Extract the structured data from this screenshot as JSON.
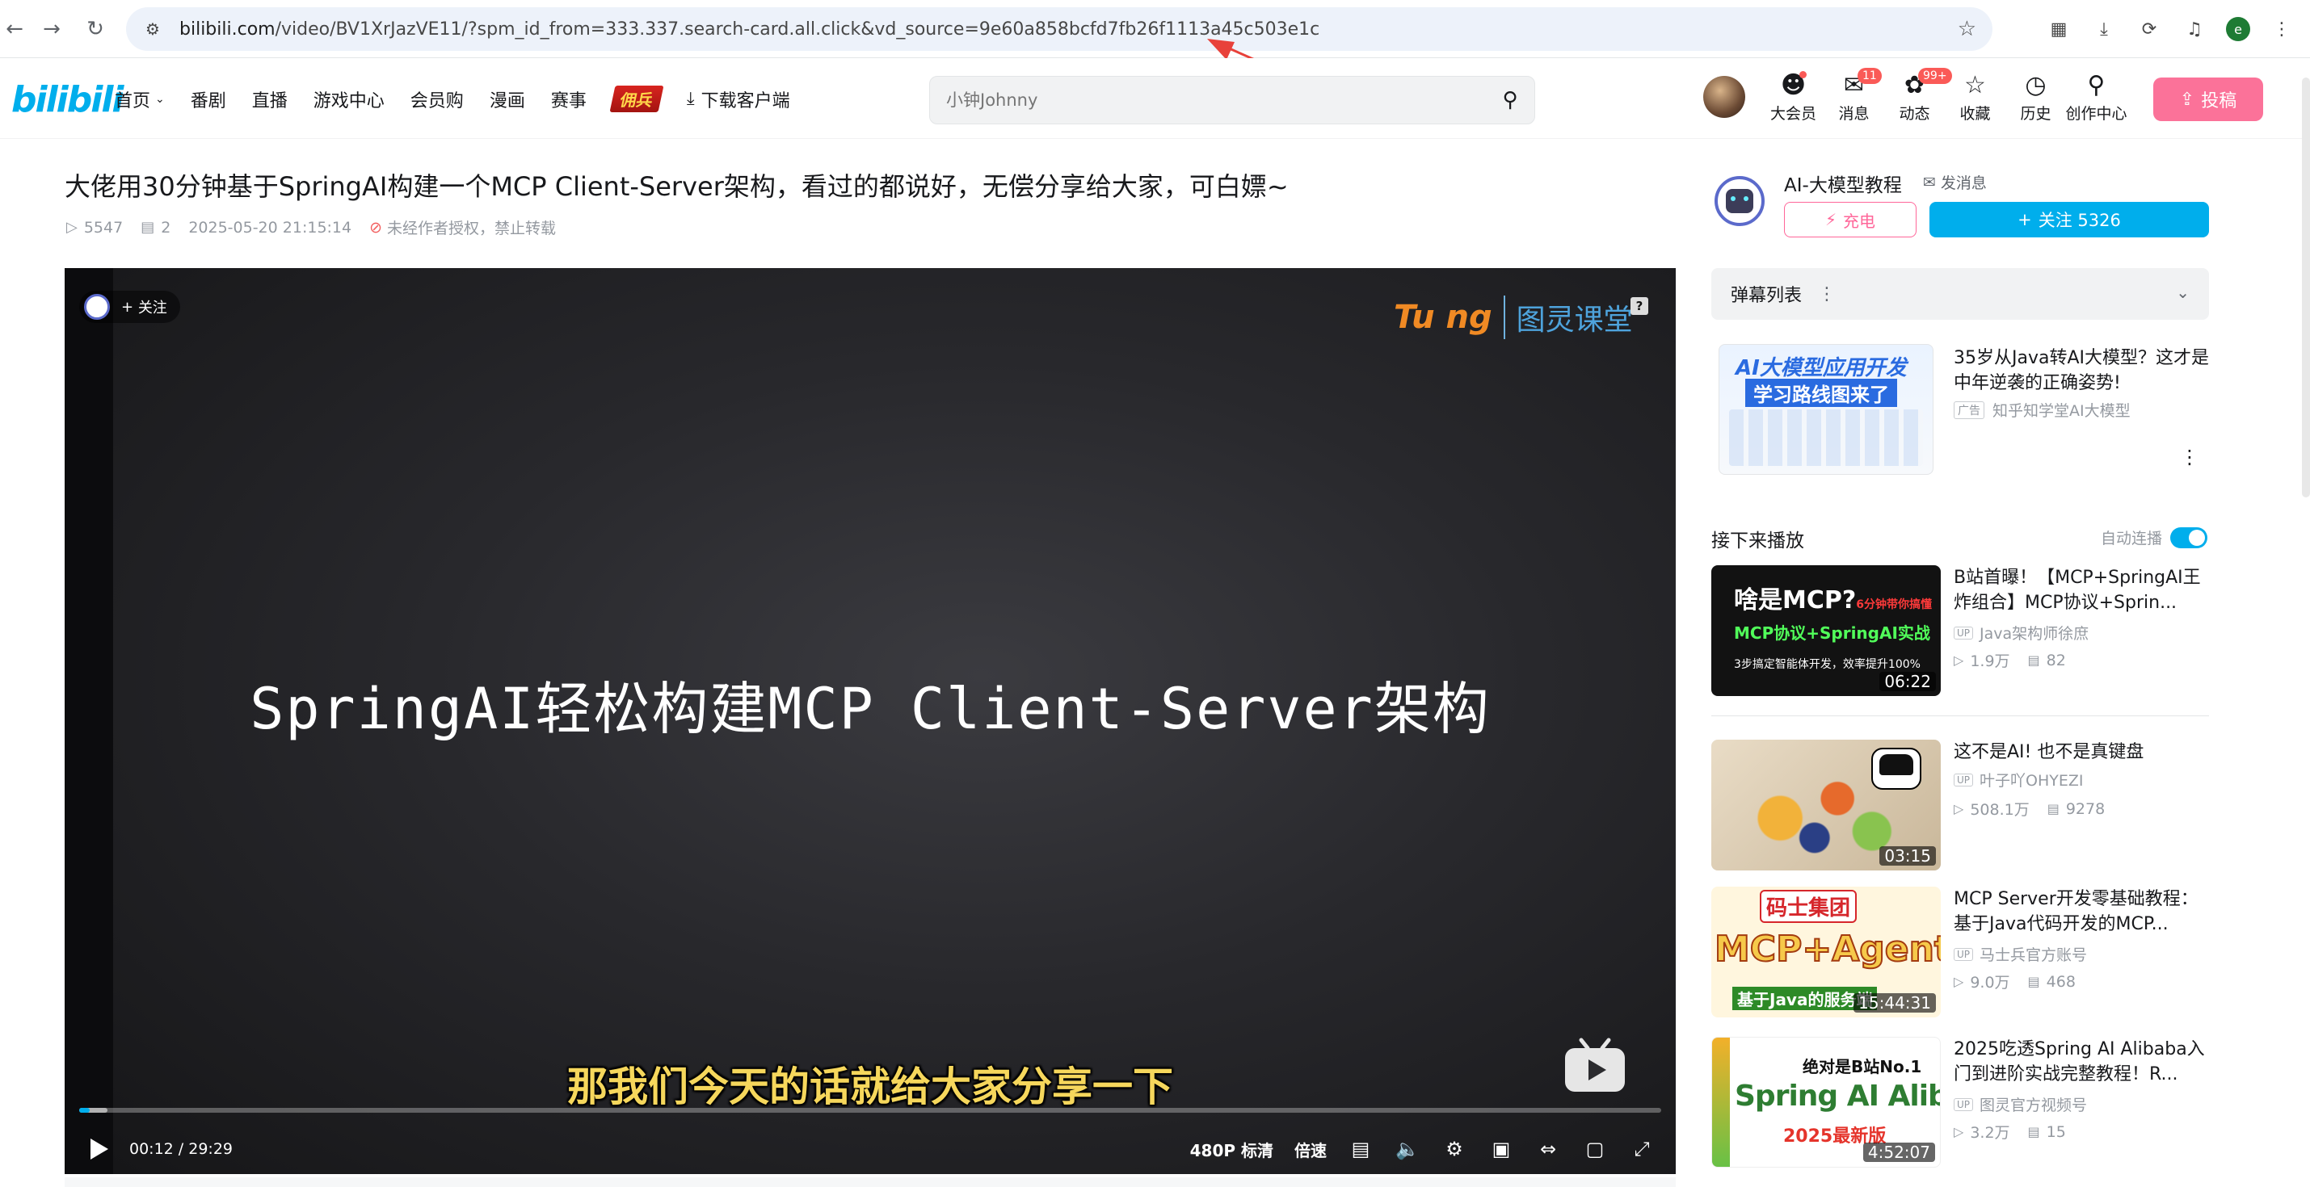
{
  "browser": {
    "url_host": "bilibili.com",
    "url_path": "/video/BV1XrJazVE11/?spm_id_from=333.337.search-card.all.click&vd_source=9e60a858bcfd7fb26f1113a45c503e1c",
    "profile_initial": "e"
  },
  "header": {
    "logo": "bilibili",
    "nav": [
      {
        "label": "首页",
        "has_dropdown": true
      },
      {
        "label": "番剧"
      },
      {
        "label": "直播"
      },
      {
        "label": "游戏中心"
      },
      {
        "label": "会员购"
      },
      {
        "label": "漫画"
      },
      {
        "label": "赛事"
      }
    ],
    "promo_label": "佣兵",
    "download_label": "下载客户端",
    "search_placeholder": "小钟Johnny",
    "icons": [
      {
        "label": "大会员",
        "icon": "member-icon",
        "dot": true
      },
      {
        "label": "消息",
        "icon": "message-icon",
        "badge": "11"
      },
      {
        "label": "动态",
        "icon": "dynamic-icon",
        "badge": "99+"
      },
      {
        "label": "收藏",
        "icon": "favorite-icon"
      },
      {
        "label": "历史",
        "icon": "history-icon"
      },
      {
        "label": "创作中心",
        "icon": "creator-icon"
      }
    ],
    "upload_label": "投稿"
  },
  "video": {
    "title": "大佬用30分钟基于SpringAI构建一个MCP Client-Server架构，看过的都说好，无偿分享给大家，可白嫖~",
    "views": "5547",
    "danmaku_count": "2",
    "date": "2025-05-20 21:15:14",
    "copyright_notice": "未经作者授权，禁止转载"
  },
  "player": {
    "follow_label": "关注",
    "brand_en": "Tu ng",
    "brand_cn": "图灵课堂",
    "slide_title": "SpringAI轻松构建MCP Client-Server架构",
    "subtitle": "那我们今天的话就给大家分享一下",
    "current_time": "00:12",
    "total_time": "29:29",
    "progress_fraction": 0.0068,
    "buffered_fraction": 0.018,
    "quality_label": "480P 标清",
    "speed_label": "倍速",
    "accent_color": "#00aeec"
  },
  "uploader": {
    "name": "AI-大模型教程",
    "message_label": "发消息",
    "charge_label": "充电",
    "follow_label": "关注 5326"
  },
  "danmaku_panel": {
    "label": "弹幕列表"
  },
  "ad": {
    "thumb_line1": "AI大模型应用开发",
    "thumb_line2": "学习路线图来了",
    "title": "35岁从Java转AI大模型？这才是中年逆袭的正确姿势!",
    "tag": "广告",
    "advertiser": "知乎知学堂AI大模型"
  },
  "up_next": {
    "label": "接下来播放",
    "autoplay_label": "自动连播",
    "autoplay_on": true
  },
  "recommendations": [
    {
      "title": "B站首曝！【MCP+SpringAI王炸组合】MCP协议+Sprin...",
      "uploader": "Java架构师徐庶",
      "views": "1.9万",
      "danmaku": "82",
      "duration": "06:22",
      "thumb_a": "啥是MCP?",
      "thumb_a_small": "6分钟带你搞懂",
      "thumb_b": "MCP协议+SpringAI实战",
      "thumb_c": "3步搞定智能体开发，效率提升100%"
    },
    {
      "title": "这不是AI!   也不是真键盘",
      "uploader": "叶子吖OHYEZI",
      "views": "508.1万",
      "danmaku": "9278",
      "duration": "03:15"
    },
    {
      "title": "MCP Server开发零基础教程：基于Java代码开发的MCP...",
      "uploader": "马士兵官方账号",
      "views": "9.0万",
      "danmaku": "468",
      "duration": "15:44:31",
      "thumb_a": "码士集团",
      "thumb_b": "MCP+Agent",
      "thumb_c": "基于Java的服务端"
    },
    {
      "title": "2025吃透Spring AI Alibaba入门到进阶实战完整教程！R...",
      "uploader": "图灵官方视频号",
      "views": "3.2万",
      "danmaku": "15",
      "duration": "4:52:07",
      "thumb_a": "绝对是B站No.1",
      "thumb_b": "Spring AI Alibaba",
      "thumb_c": "2025最新版"
    }
  ]
}
